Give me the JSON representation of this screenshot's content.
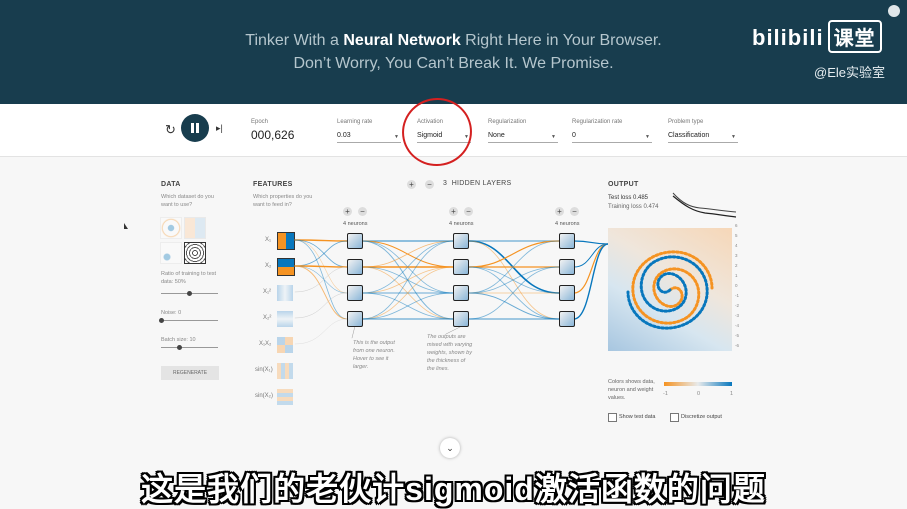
{
  "header": {
    "line1_pre": "Tinker With a ",
    "line1_bold": "Neural Network",
    "line1_post": " Right Here in Your Browser.",
    "line2": "Don’t Worry, You Can’t Break It. We Promise.",
    "logo": "bilibili",
    "logo_box": "课堂",
    "watermark": "@Ele实验室"
  },
  "controls": {
    "epoch_label": "Epoch",
    "epoch_value": "000,626",
    "learning_rate_label": "Learning rate",
    "learning_rate_value": "0.03",
    "activation_label": "Activation",
    "activation_value": "Sigmoid",
    "regularization_label": "Regularization",
    "regularization_value": "None",
    "reg_rate_label": "Regularization rate",
    "reg_rate_value": "0",
    "problem_label": "Problem type",
    "problem_value": "Classification"
  },
  "data_panel": {
    "title": "DATA",
    "subtitle": "Which dataset do you want to use?",
    "ratio_label": "Ratio of training to test data:",
    "ratio_value": "50%",
    "ratio_fraction": 0.5,
    "noise_label": "Noise:",
    "noise_value": "0",
    "noise_fraction": 0.0,
    "batch_label": "Batch size:",
    "batch_value": "10",
    "batch_fraction": 0.33,
    "regenerate": "REGENERATE"
  },
  "features": {
    "title": "FEATURES",
    "subtitle": "Which properties do you want to feed in?",
    "items": [
      "X₁",
      "X₂",
      "X₁²",
      "X₂²",
      "X₁X₂",
      "sin(X₁)",
      "sin(X₂)"
    ]
  },
  "network": {
    "plus": "+",
    "minus": "−",
    "hidden_count": "3",
    "hidden_label": "HIDDEN LAYERS",
    "layers": [
      "4 neurons",
      "4 neurons",
      "4 neurons"
    ],
    "note1": "This is the output from one neuron. Hover to see it larger.",
    "note2": "The outputs are mixed with varying weights, shown by the thickness of the lines."
  },
  "output": {
    "title": "OUTPUT",
    "test_loss": "Test loss 0.485",
    "training_loss": "Training loss 0.474",
    "legend_text": "Colors shows data, neuron and weight values.",
    "scale": [
      "-1",
      "0",
      "1"
    ],
    "show_test": "Show test data",
    "discretize": "Discretize output",
    "axis_ticks": [
      "6",
      "5",
      "4",
      "3",
      "2",
      "1",
      "0",
      "-1",
      "-2",
      "-3",
      "-4",
      "-5",
      "-6"
    ],
    "colors": {
      "negative": "#f59322",
      "positive": "#0877bd"
    }
  },
  "subtitle": "这是我们的老伙计sigmoid激活函数的问题"
}
